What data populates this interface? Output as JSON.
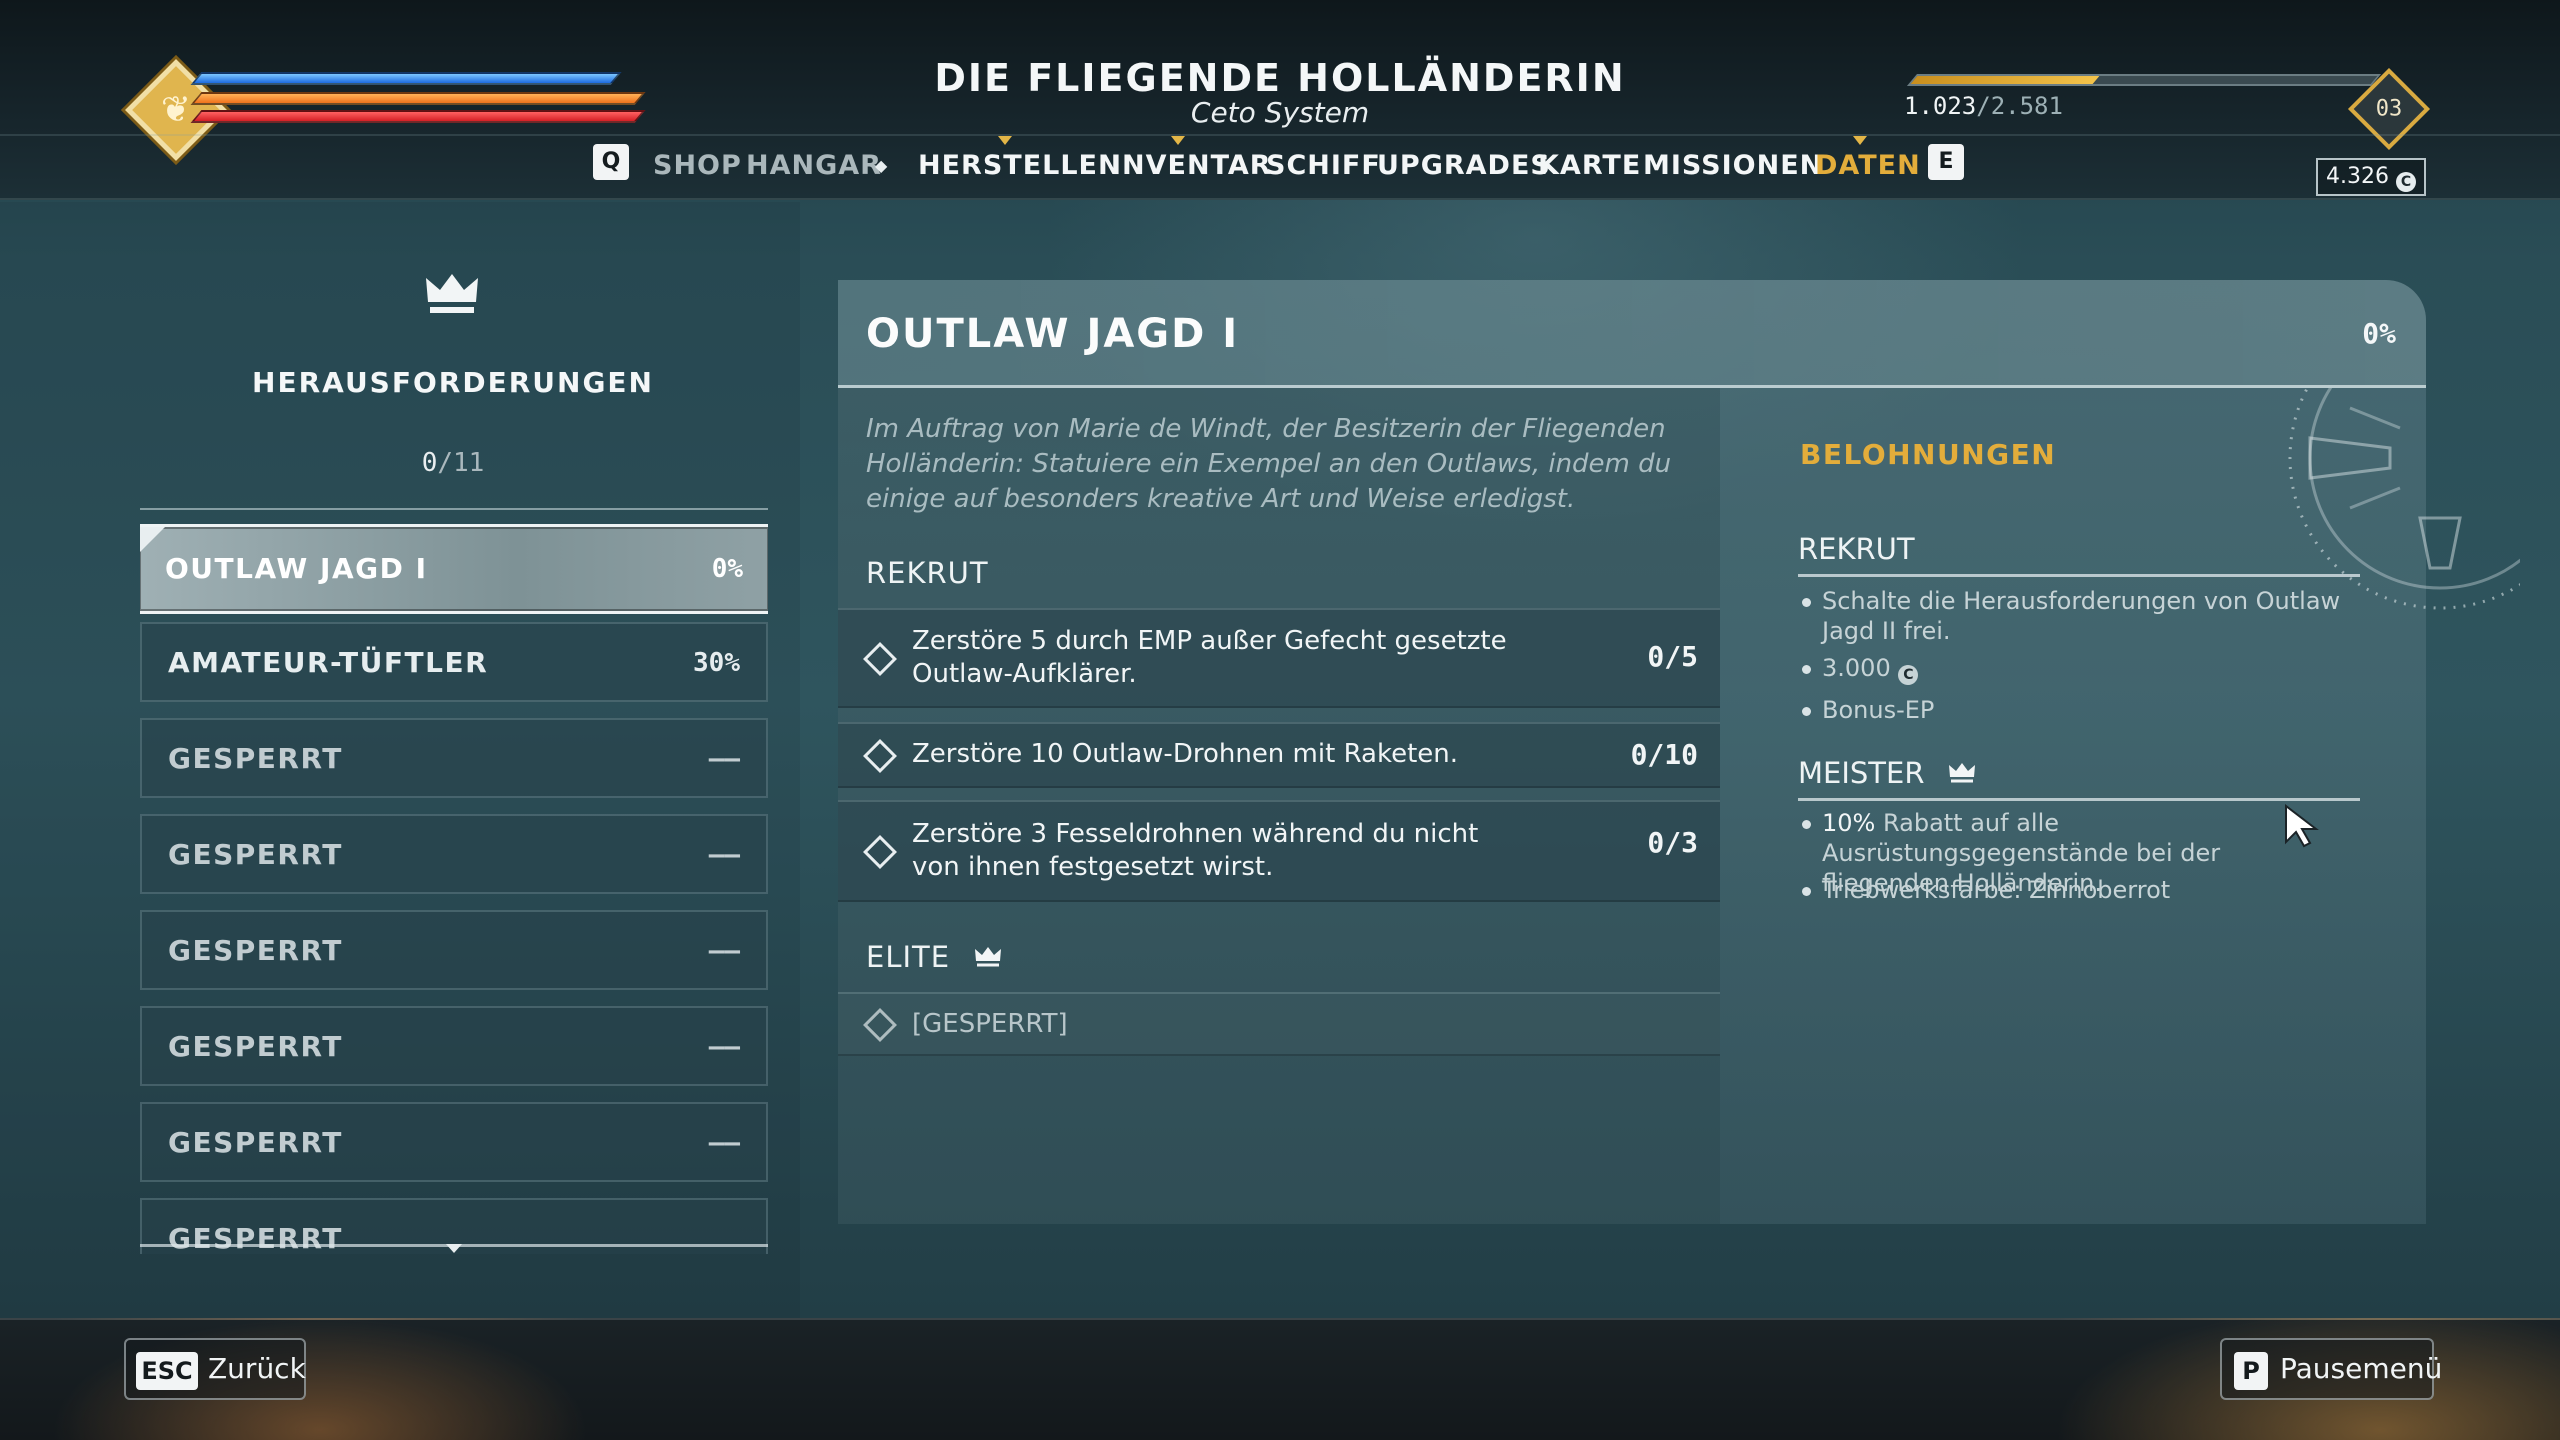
{
  "hud": {
    "ship_name": "DIE FLIEGENDE HOLLÄNDERIN",
    "system": "Ceto System",
    "xp_current": "1.023",
    "xp_max": "2.581",
    "xp_fraction": 0.396,
    "level": "03",
    "credits": "4.326",
    "credit_icon": "C",
    "emblem_icon": "❦"
  },
  "nav": {
    "key_left": "Q",
    "key_right": "E",
    "items": [
      {
        "label": "SHOP"
      },
      {
        "label": "HANGAR"
      },
      {
        "label": "HERSTELLEN"
      },
      {
        "label": "INVENTAR"
      },
      {
        "label": "SCHIFF"
      },
      {
        "label": "UPGRADES"
      },
      {
        "label": "KARTE"
      },
      {
        "label": "MISSIONEN"
      },
      {
        "label": "DATEN"
      }
    ],
    "separator": "◆",
    "active": "DATEN"
  },
  "challenges": {
    "title": "HERAUSFORDERUNGEN",
    "completed": "0",
    "total": "11",
    "list": [
      {
        "label": "OUTLAW JAGD I",
        "pct": "0%"
      },
      {
        "label": "AMATEUR-TÜFTLER",
        "pct": "30%"
      },
      {
        "label": "GESPERRT",
        "pct": "––"
      },
      {
        "label": "GESPERRT",
        "pct": "––"
      },
      {
        "label": "GESPERRT",
        "pct": "––"
      },
      {
        "label": "GESPERRT",
        "pct": "––"
      },
      {
        "label": "GESPERRT",
        "pct": "––"
      },
      {
        "label": "GESPERRT",
        "pct": ""
      }
    ]
  },
  "detail": {
    "title": "OUTLAW JAGD I",
    "pct": "0%",
    "description": "Im Auftrag von Marie de Windt, der Besitzerin der Fliegenden Holländerin: Statuiere ein Exempel an den Outlaws, indem du einige auf besonders kreative Art und Weise erledigst.",
    "tier1": "REKRUT",
    "tasks": [
      {
        "text": "Zerstöre 5 durch EMP außer Gefecht gesetzte Outlaw-Aufklärer.",
        "progress": "0/5"
      },
      {
        "text": "Zerstöre 10 Outlaw-Drohnen mit Raketen.",
        "progress": "0/10"
      },
      {
        "text": "Zerstöre 3 Fesseldrohnen während du nicht von ihnen festgesetzt wirst.",
        "progress": "0/3"
      }
    ],
    "tier2": "ELITE",
    "elite_task": "[GESPERRT]"
  },
  "rewards": {
    "heading": "BELOHNUNGEN",
    "rekrut_label": "REKRUT",
    "rekrut_items": [
      "Schalte die Herausforderungen von Outlaw Jagd II frei.",
      "3.000",
      "Bonus-EP"
    ],
    "meister_label": "MEISTER",
    "meister_items": [
      {
        "highlight": "10%",
        "text": " Rabatt auf alle Ausrüstungsgegenstände bei der fliegenden Holländerin."
      },
      {
        "highlight": "",
        "text": "Triebwerksfarbe: Zinnoberrot"
      }
    ]
  },
  "footer": {
    "back_key": "ESC",
    "back_label": "Zurück",
    "pause_key": "P",
    "pause_label": "Pausemenü"
  }
}
